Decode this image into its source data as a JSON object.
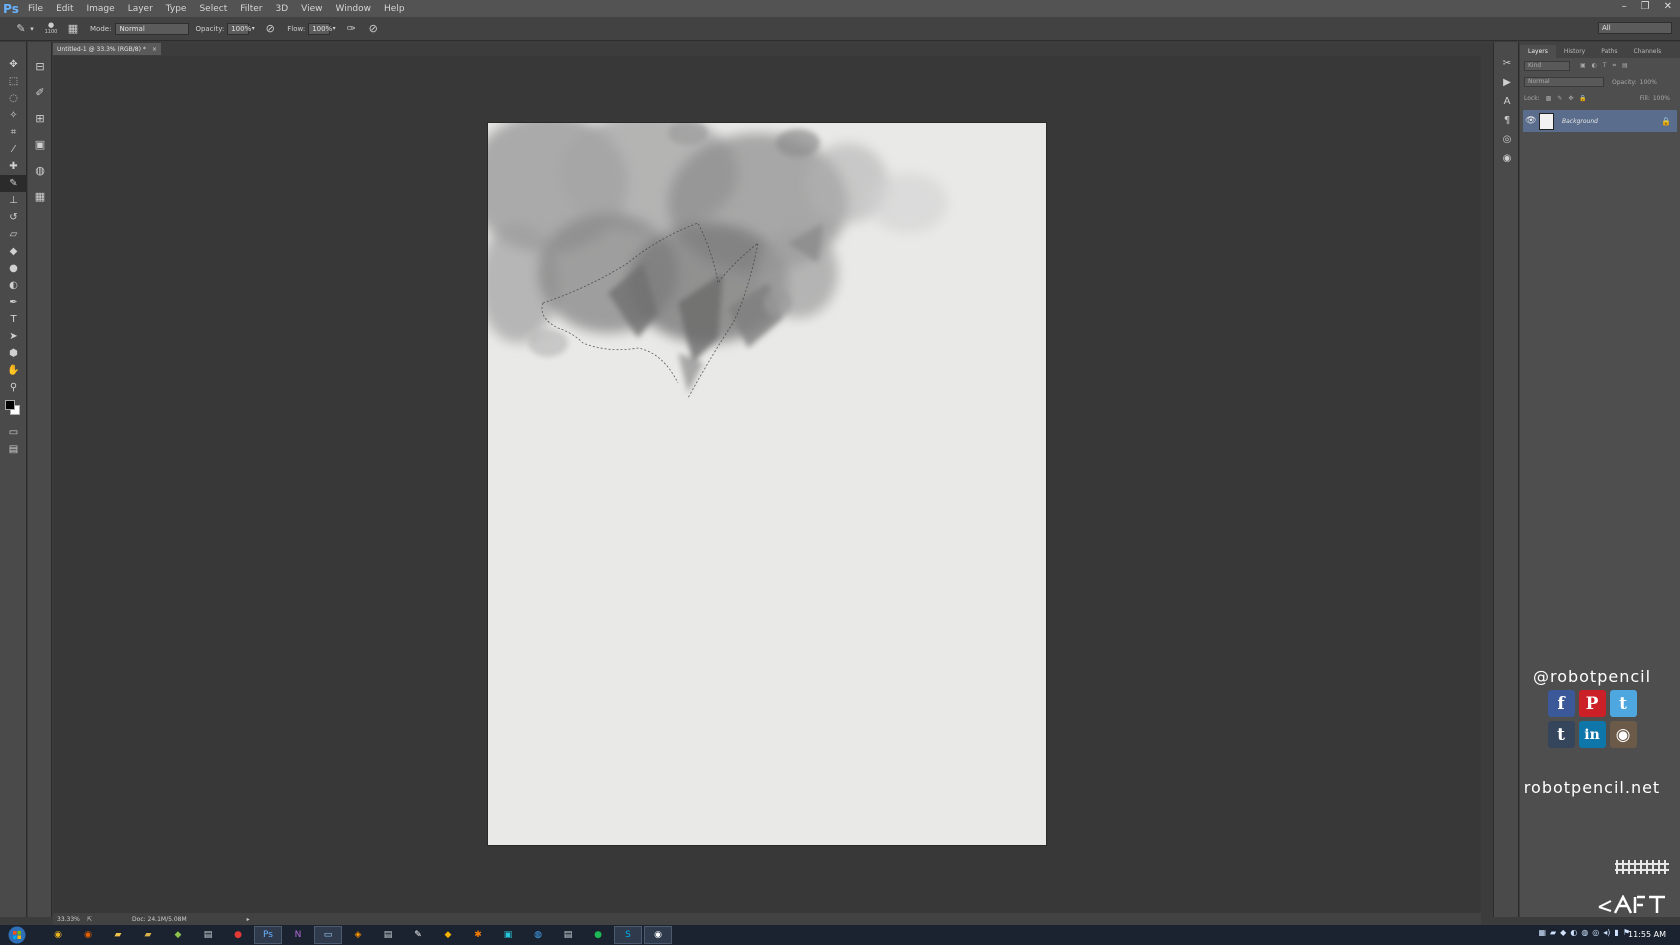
{
  "menubar": {
    "logo": "Ps",
    "items": [
      "File",
      "Edit",
      "Image",
      "Layer",
      "Type",
      "Select",
      "Filter",
      "3D",
      "View",
      "Window",
      "Help"
    ]
  },
  "options": {
    "brush_size": "1100",
    "mode_label": "Mode:",
    "mode_value": "Normal",
    "opacity_label": "Opacity:",
    "opacity_value": "100%",
    "flow_label": "Flow:",
    "flow_value": "100%",
    "workspace": "All"
  },
  "document": {
    "tab_title": "Untitled-1 @ 33.3% (RGB/8) *",
    "tab_close": "×"
  },
  "status": {
    "zoom": "33.33%",
    "doc_size": "Doc: 24.1M/5.08M"
  },
  "layers_panel": {
    "tabs": [
      "Layers",
      "History",
      "Paths",
      "Channels"
    ],
    "kind": "Kind",
    "blend_mode": "Normal",
    "opacity_label": "Opacity:",
    "opacity_value": "100%",
    "lock_label": "Lock:",
    "fill_label": "Fill:",
    "fill_value": "100%",
    "layer_name": "Background"
  },
  "social": {
    "handle": "@robotpencil",
    "site": "robotpencil.net",
    "row1": [
      {
        "icon": "facebook-icon",
        "glyph": "f",
        "color": "#3b5998"
      },
      {
        "icon": "pinterest-icon",
        "glyph": "P",
        "color": "#cb2027"
      },
      {
        "icon": "twitter-icon",
        "glyph": "t",
        "color": "#4fa7e0"
      }
    ],
    "row2": [
      {
        "icon": "tumblr-icon",
        "glyph": "t",
        "color": "#35465c"
      },
      {
        "icon": "linkedin-icon",
        "glyph": "in",
        "color": "#0e76a8"
      },
      {
        "icon": "instagram-icon",
        "glyph": "◉",
        "color": "#6b5a48"
      }
    ]
  },
  "taskbar": {
    "clock": "11:55 AM"
  },
  "colors": {
    "menubar": "#535353",
    "panel": "#4e4e4e",
    "canvas_bg": "#383838",
    "document": "#e9eae8",
    "selected_layer": "#5a6d8c"
  }
}
